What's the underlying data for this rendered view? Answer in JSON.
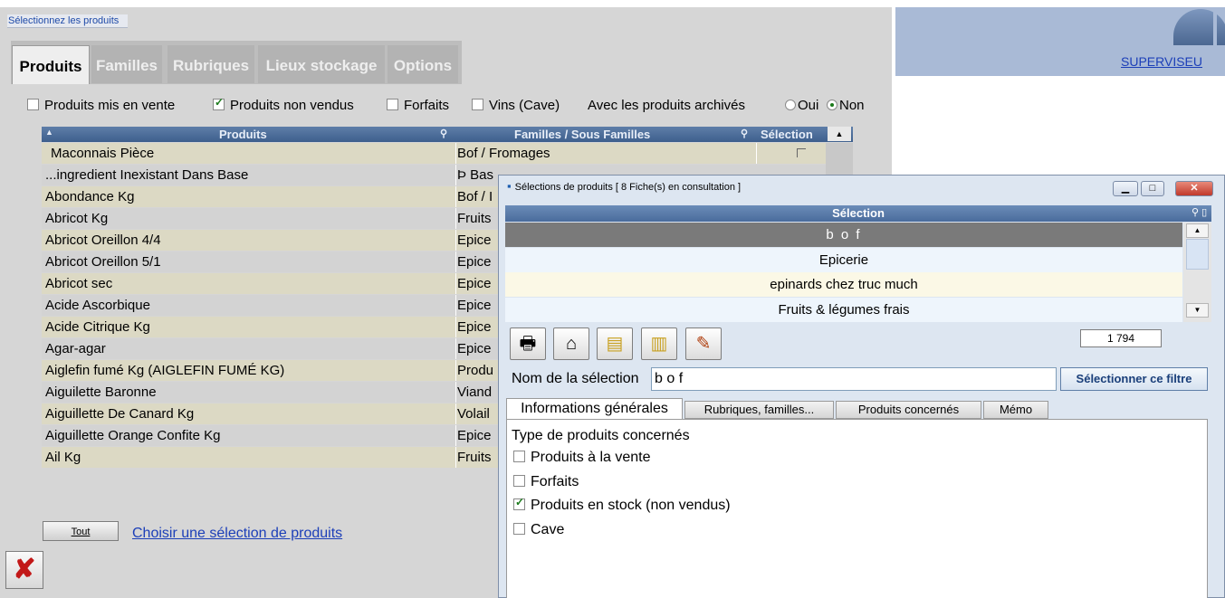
{
  "window": {
    "caption": "Sélectionnez les produits"
  },
  "tabs": [
    "Produits",
    "Familles",
    "Rubriques",
    "Lieux stockage",
    "Options"
  ],
  "filters": {
    "produits_mis_en_vente": {
      "label": "Produits mis en vente",
      "checked": false
    },
    "produits_non_vendus": {
      "label": "Produits non vendus",
      "checked": true
    },
    "forfaits": {
      "label": "Forfaits",
      "checked": false
    },
    "vins_cave": {
      "label": "Vins (Cave)",
      "checked": false
    },
    "archived_label": "Avec les produits archivés",
    "radio_oui": "Oui",
    "radio_non": "Non",
    "radio_selected": "Non"
  },
  "grid": {
    "columns": [
      "Produits",
      "Familles / Sous Familles",
      "Sélection"
    ],
    "rows": [
      {
        "product": "Maconnais Pièce",
        "family": "Bof / Fromages"
      },
      {
        "product": "...ingredient Inexistant Dans Base",
        "family": "Þ Bas"
      },
      {
        "product": "Abondance Kg",
        "family": "Bof / I"
      },
      {
        "product": "Abricot Kg",
        "family": "Fruits"
      },
      {
        "product": "Abricot Oreillon 4/4",
        "family": "Epice"
      },
      {
        "product": "Abricot Oreillon 5/1",
        "family": "Epice"
      },
      {
        "product": "Abricot sec",
        "family": "Epice"
      },
      {
        "product": "Acide Ascorbique",
        "family": "Epice"
      },
      {
        "product": "Acide Citrique Kg",
        "family": "Epice"
      },
      {
        "product": "Agar-agar",
        "family": "Epice"
      },
      {
        "product": "Aiglefin fumé Kg (AIGLEFIN FUMÉ KG)",
        "family": "Produ"
      },
      {
        "product": "Aiguilette Baronne",
        "family": "Viand"
      },
      {
        "product": "Aiguillette De Canard Kg",
        "family": "Volail"
      },
      {
        "product": "Aiguillette Orange Confite Kg",
        "family": "Epice"
      },
      {
        "product": "Ail Kg",
        "family": "Fruits"
      }
    ]
  },
  "bottom": {
    "tout_label": "Tout",
    "choisir_link": "Choisir une sélection de produits"
  },
  "right": {
    "superviseur_link": "SUPERVISEU"
  },
  "dialog": {
    "title": "Sélections de produits  [ 8 Fiche(s) en consultation ]",
    "selection_header": "Sélection",
    "selections": [
      "b o f",
      "Epicerie",
      "epinards chez truc much",
      "Fruits & légumes frais"
    ],
    "count": "1 794",
    "nom_label": "Nom de la sélection",
    "nom_value": "b o f",
    "filter_button": "Sélectionner ce filtre",
    "tabs": [
      "Informations générales",
      "Rubriques, familles...",
      "Produits concernés",
      "Mémo"
    ],
    "type_title": "Type de produits concernés",
    "options": [
      {
        "label": "Produits à la vente",
        "checked": false
      },
      {
        "label": "Forfaits",
        "checked": false
      },
      {
        "label": "Produits en stock (non vendus)",
        "checked": true
      },
      {
        "label": "Cave",
        "checked": false
      }
    ]
  },
  "colors": {
    "grid_header": "#4a6a96",
    "row_odd": "#dcd9c4",
    "row_even": "#d3d3d3",
    "link": "#1c3fb8",
    "close_red": "#c21818"
  }
}
